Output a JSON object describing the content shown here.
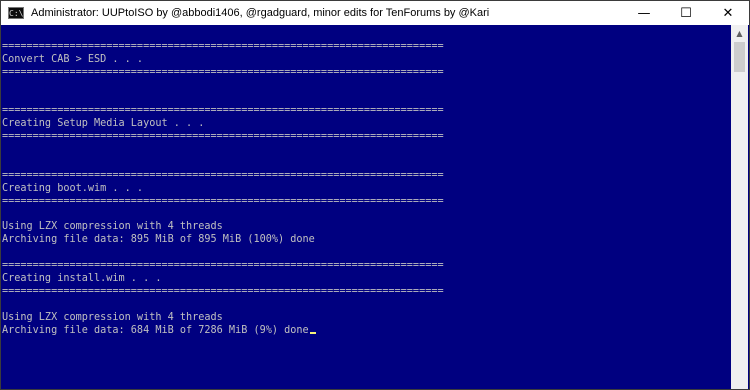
{
  "window": {
    "icon_text": "C:\\",
    "title": "Administrator:  UUPtoISO by @abbodi1406, @rgadguard, minor edits for TenForums by @Kari",
    "controls": {
      "minimize": "—",
      "maximize": "☐",
      "close": "✕"
    }
  },
  "console": {
    "lines": [
      "========================================================================",
      "Convert CAB > ESD . . .",
      "========================================================================",
      "",
      "",
      "========================================================================",
      "Creating Setup Media Layout . . .",
      "========================================================================",
      "",
      "",
      "========================================================================",
      "Creating boot.wim . . .",
      "========================================================================",
      "",
      "Using LZX compression with 4 threads",
      "Archiving file data: 895 MiB of 895 MiB (100%) done",
      "",
      "========================================================================",
      "Creating install.wim . . .",
      "========================================================================",
      "",
      "Using LZX compression with 4 threads",
      "Archiving file data: 684 MiB of 7286 MiB (9%) done"
    ]
  },
  "scrollbar": {
    "up_arrow": "▲"
  }
}
